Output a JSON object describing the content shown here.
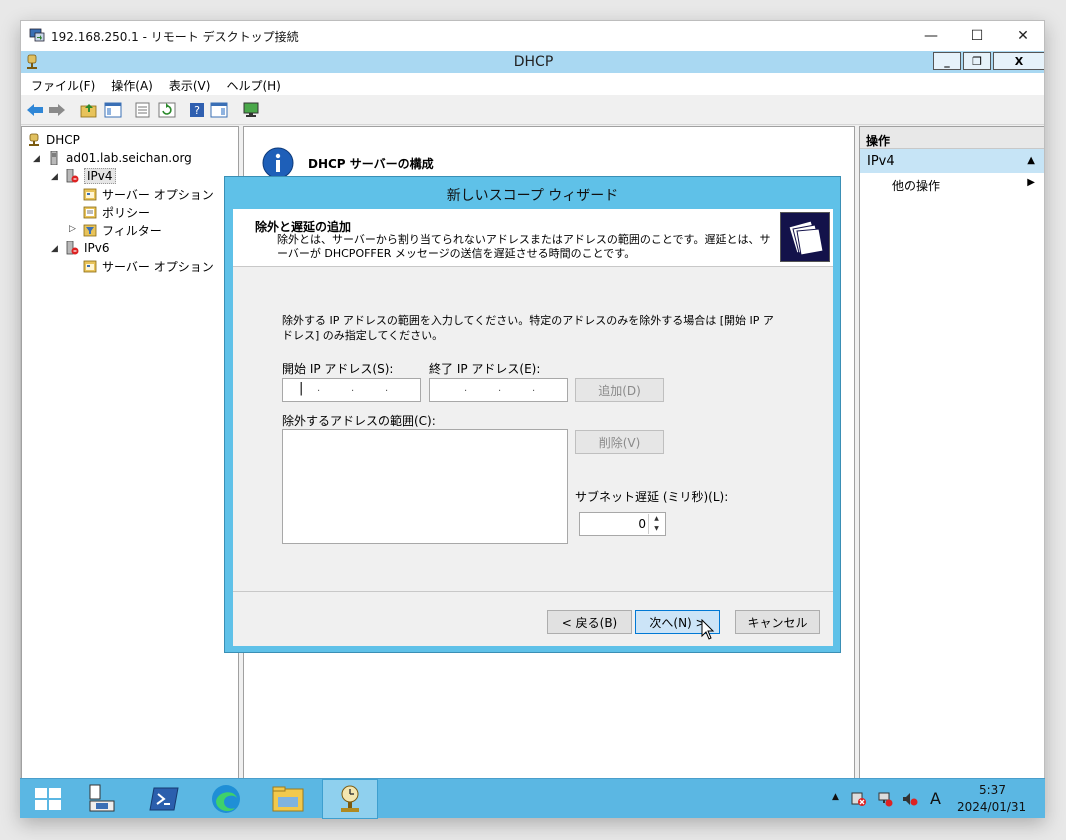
{
  "rdp": {
    "title": "192.168.250.1 - リモート デスクトップ接続",
    "minimize": "—",
    "maximize": "☐",
    "close": "✕"
  },
  "dhcp": {
    "title": "DHCP",
    "mdi_min": "_",
    "mdi_restore": "❐",
    "mdi_close": "X"
  },
  "menu": [
    "ファイル(F)",
    "操作(A)",
    "表示(V)",
    "ヘルプ(H)"
  ],
  "tree": {
    "root": "DHCP",
    "server": "ad01.lab.seichan.org",
    "ipv4": "IPv4",
    "server_options": "サーバー オプション",
    "policy": "ポリシー",
    "filter": "フィルター",
    "ipv6": "IPv6",
    "server_options6": "サーバー オプション"
  },
  "center": {
    "info_title": "DHCP サーバーの構成"
  },
  "action": {
    "header": "操作",
    "section": "IPv4",
    "more": "他の操作"
  },
  "wizard": {
    "title": "新しいスコープ ウィザード",
    "header_title": "除外と遅延の追加",
    "header_desc": "除外とは、サーバーから割り当てられないアドレスまたはアドレスの範囲のことです。遅延とは、サーバーが DHCPOFFER メッセージの送信を遅延させる時間のことです。",
    "intro": "除外する IP アドレスの範囲を入力してください。特定のアドレスのみを除外する場合は [開始 IP アドレス] のみ指定してください。",
    "start_ip_label": "開始 IP アドレス(S):",
    "end_ip_label": "終了 IP アドレス(E):",
    "add_button": "追加(D)",
    "excluded_label": "除外するアドレスの範囲(C):",
    "remove_button": "削除(V)",
    "delay_label": "サブネット遅延 (ミリ秒)(L):",
    "delay_value": "0",
    "back_button": "< 戻る(B)",
    "next_button": "次へ(N) >",
    "cancel_button": "キャンセル"
  },
  "taskbar": {
    "time": "5:37",
    "date": "2024/01/31",
    "ime": "A",
    "tray_arrow": "▲"
  },
  "colors": {
    "accent": "#5fc1e8",
    "taskbar": "#5bb7e3",
    "title_bar": "#a9d8f2"
  }
}
